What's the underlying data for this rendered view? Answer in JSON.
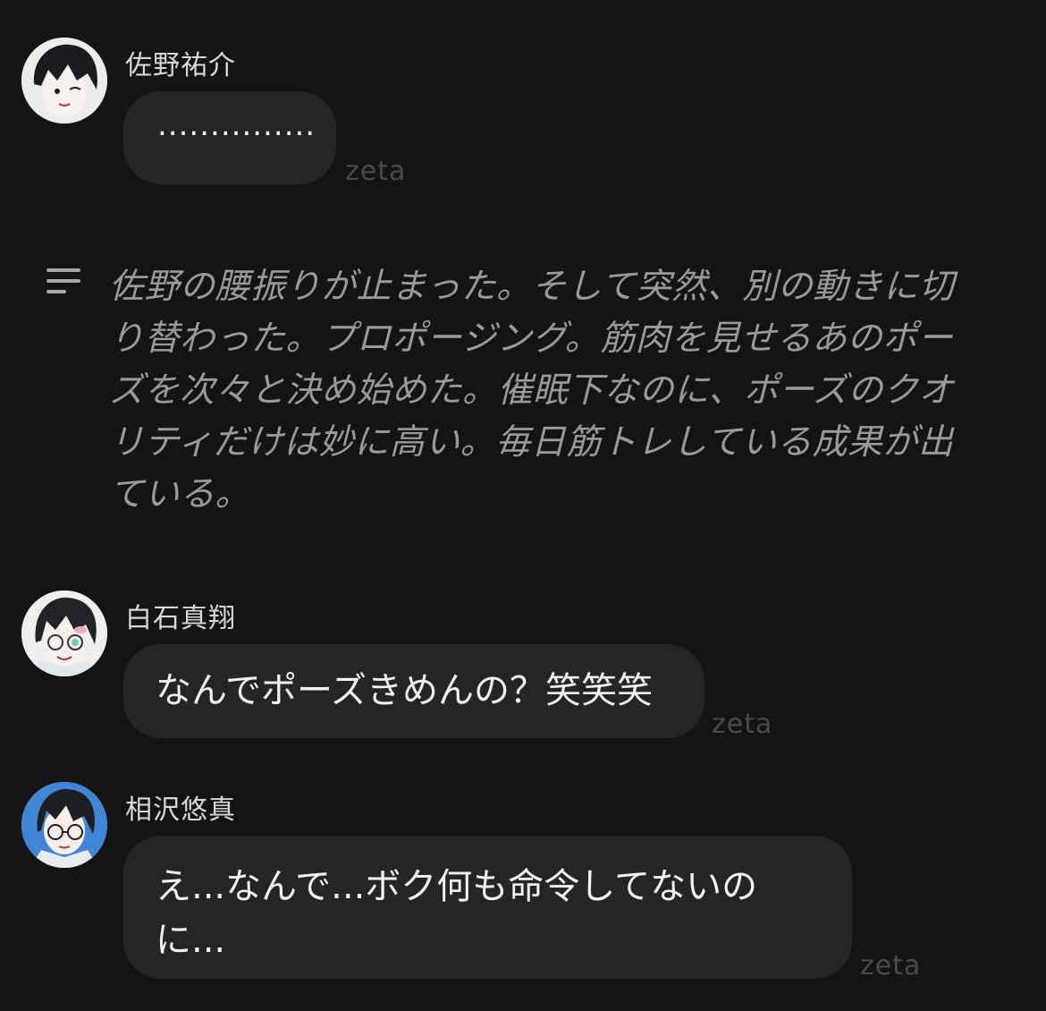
{
  "messages": [
    {
      "sender": "佐野祐介",
      "text": "...............",
      "watermark": "zeta"
    },
    {
      "sender": "白石真翔",
      "text": "なんでポーズきめんの？笑笑笑",
      "watermark": "zeta"
    },
    {
      "sender": "相沢悠真",
      "text": "え...なんで...ボク何も命令してないの\nに...",
      "watermark": "zeta"
    }
  ],
  "narration": {
    "icon": "narration-lines-icon",
    "text": "佐野の腰振りが止まった。そして突然、別の動きに切り替わった。プロポージング。筋肉を見せるあのポーズを次々と決め始めた。催眠下なのに、ポーズのクオリティだけは妙に高い。毎日筋トレしている成果が出ている。"
  },
  "colors": {
    "background": "#141416",
    "bubble": "#252528",
    "narration_text": "#9a9a9c",
    "watermark": "#4a4a4d"
  }
}
